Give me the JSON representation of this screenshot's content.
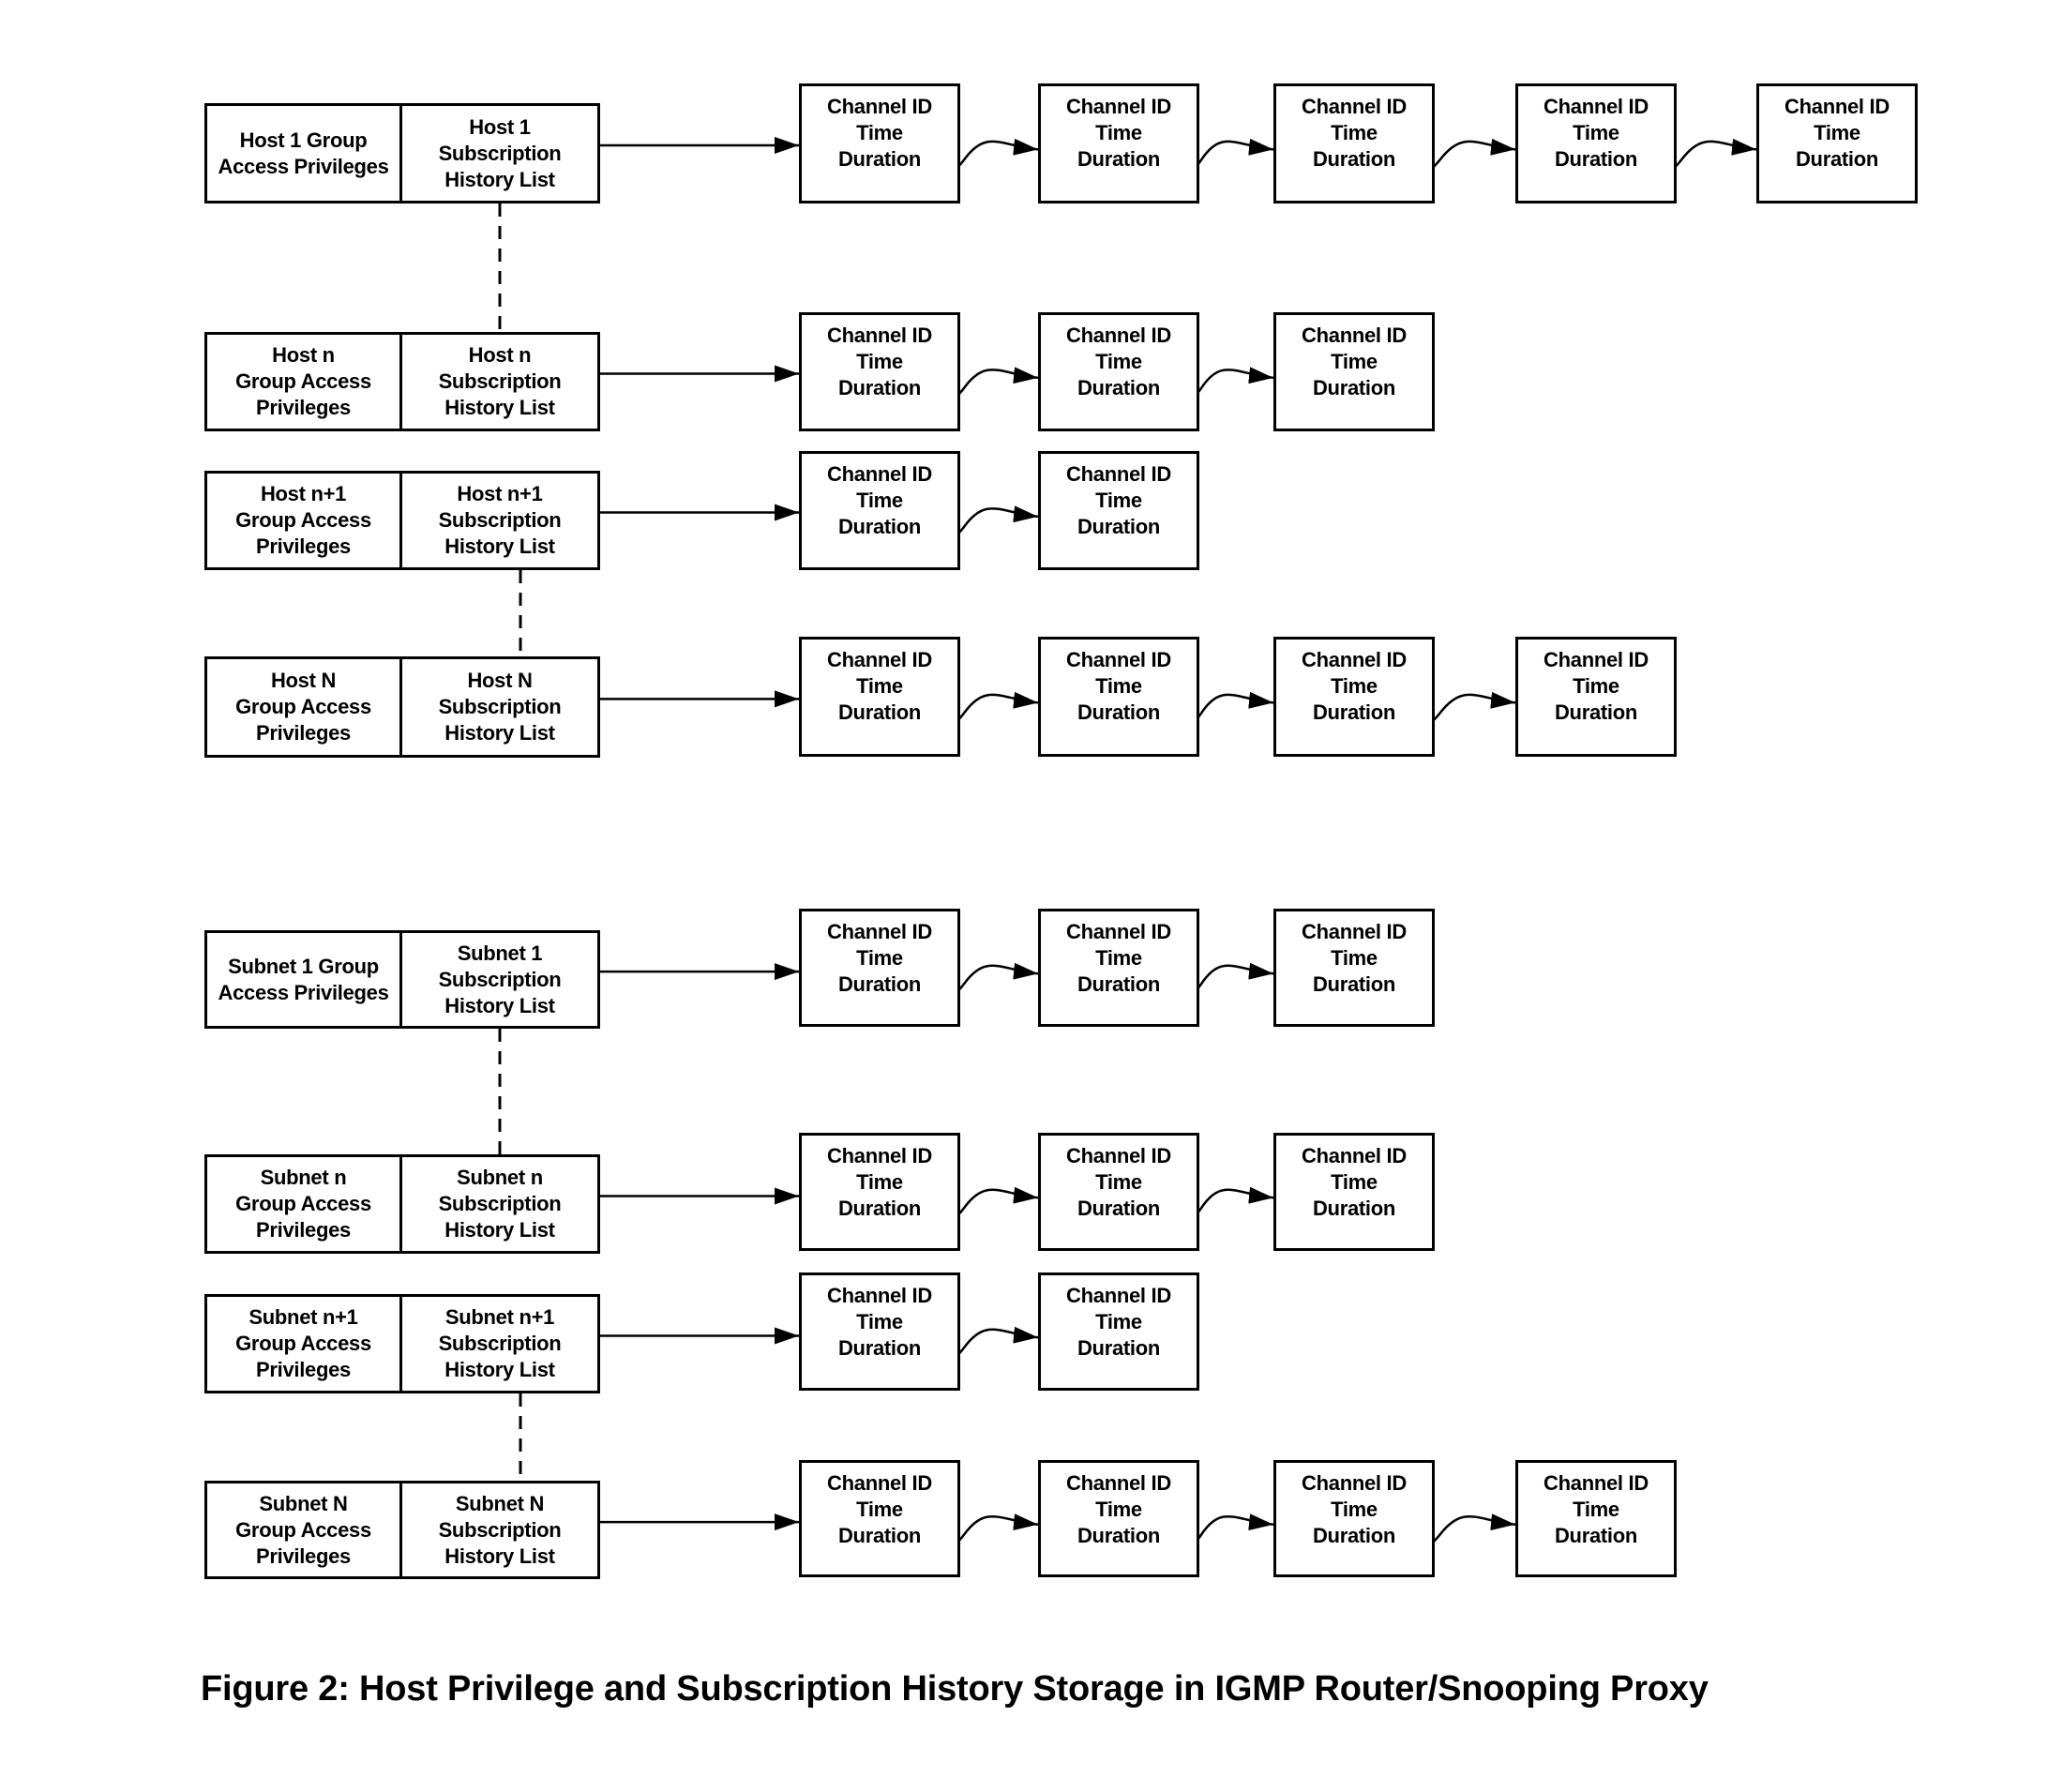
{
  "caption": "Figure 2: Host Privilege and Subscription History Storage in IGMP Router/Snooping Proxy",
  "channel_record": {
    "line1": "Channel ID",
    "line2": "Time",
    "line3": "Duration"
  },
  "rows": [
    {
      "id": "host-1",
      "privileges": "Host 1 Group\nAccess Privileges",
      "history": "Host 1\nSubscription\nHistory List",
      "channel_count": 5
    },
    {
      "id": "host-n",
      "privileges": "Host n\nGroup Access\nPrivileges",
      "history": "Host n\nSubscription\nHistory List",
      "channel_count": 3
    },
    {
      "id": "host-n-plus-1",
      "privileges": "Host n+1\nGroup Access\nPrivileges",
      "history": "Host  n+1\nSubscription\nHistory List",
      "channel_count": 2
    },
    {
      "id": "host-N",
      "privileges": "Host N\nGroup Access\nPrivileges",
      "history": "Host N\nSubscription\nHistory List",
      "channel_count": 4
    },
    {
      "id": "subnet-1",
      "privileges": "Subnet 1 Group\nAccess Privileges",
      "history": "Subnet 1\nSubscription\nHistory List",
      "channel_count": 3
    },
    {
      "id": "subnet-n",
      "privileges": "Subnet n\nGroup Access\nPrivileges",
      "history": "Subnet n\nSubscription\nHistory List",
      "channel_count": 3
    },
    {
      "id": "subnet-n-plus-1",
      "privileges": "Subnet n+1\nGroup Access\nPrivileges",
      "history": "Subnet  n+1\nSubscription\nHistory List",
      "channel_count": 2
    },
    {
      "id": "subnet-N",
      "privileges": "Subnet N\nGroup Access\nPrivileges",
      "history": "Subnet N\nSubscription\nHistory List",
      "channel_count": 4
    }
  ],
  "ellipsis_links": [
    {
      "from": "host-1",
      "to": "host-n"
    },
    {
      "from": "host-n-plus-1",
      "to": "host-N"
    },
    {
      "from": "subnet-1",
      "to": "subnet-n"
    },
    {
      "from": "subnet-n-plus-1",
      "to": "subnet-N"
    }
  ]
}
